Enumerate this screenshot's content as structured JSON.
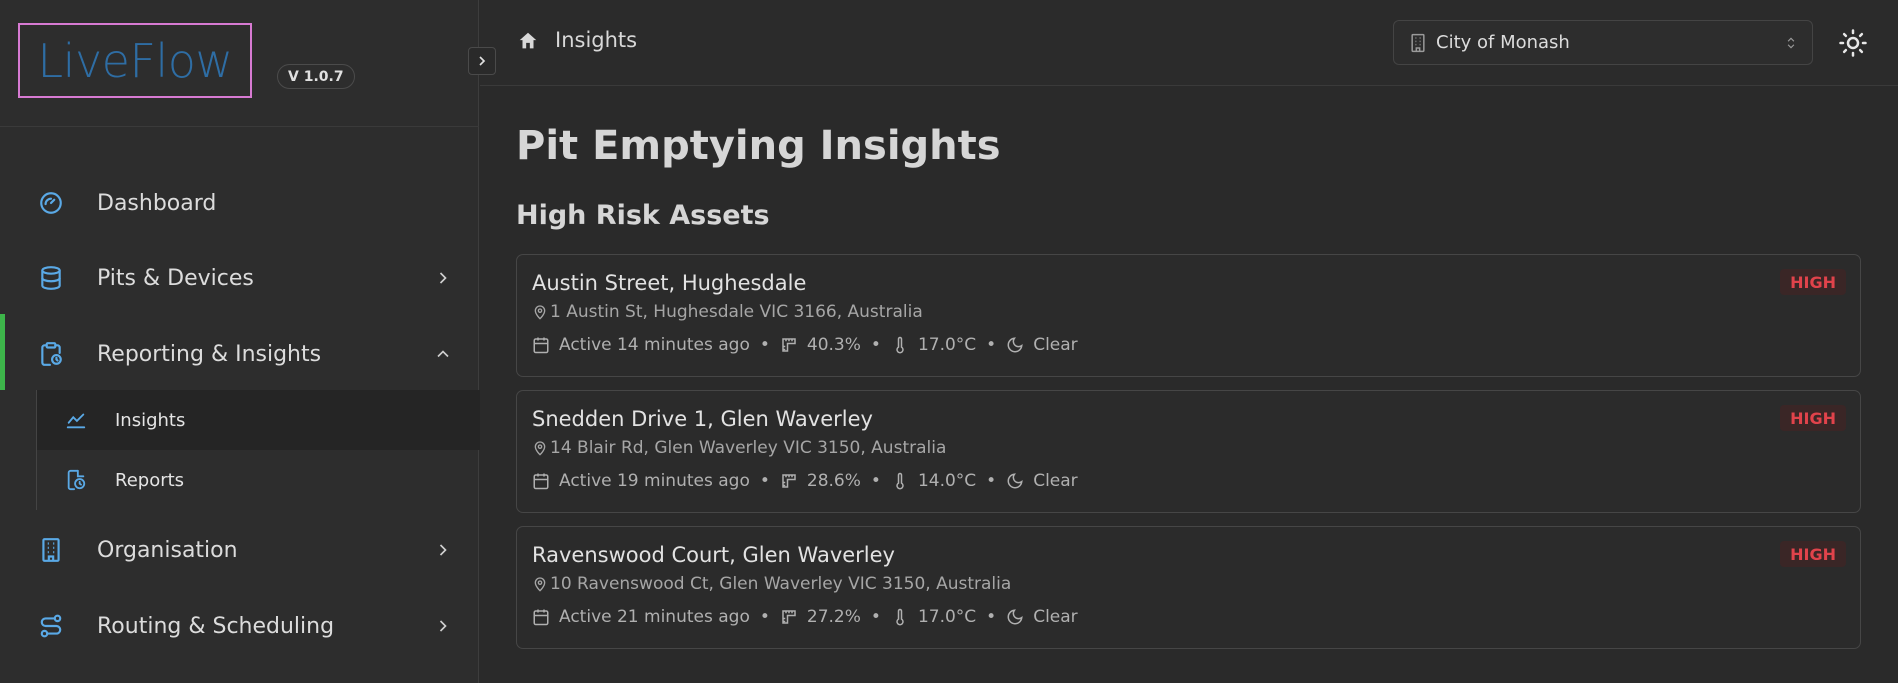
{
  "app": {
    "logo": "LiveFlow",
    "version": "V 1.0.7"
  },
  "sidebar": {
    "items": [
      {
        "label": "Dashboard",
        "icon": "gauge-icon"
      },
      {
        "label": "Pits & Devices",
        "icon": "database-icon",
        "has_children": true
      },
      {
        "label": "Reporting & Insights",
        "icon": "clipboard-clock-icon",
        "expanded": true,
        "active": true
      },
      {
        "label": "Organisation",
        "icon": "building-icon",
        "has_children": true
      },
      {
        "label": "Routing & Scheduling",
        "icon": "route-icon",
        "has_children": true
      }
    ],
    "subitems": [
      {
        "label": "Insights",
        "icon": "line-chart-icon",
        "active": true
      },
      {
        "label": "Reports",
        "icon": "file-clock-icon"
      }
    ]
  },
  "topbar": {
    "breadcrumb": "Insights",
    "organisation": "City of Monash"
  },
  "main": {
    "title": "Pit Emptying Insights",
    "section": "High Risk Assets",
    "assets": [
      {
        "name": "Austin Street, Hughesdale",
        "address": "1 Austin St, Hughesdale VIC 3166, Australia",
        "active": "Active 14 minutes ago",
        "level": "40.3%",
        "temp": "17.0°C",
        "weather": "Clear",
        "risk": "HIGH"
      },
      {
        "name": "Snedden Drive 1, Glen Waverley",
        "address": "14 Blair Rd, Glen Waverley VIC 3150, Australia",
        "active": "Active 19 minutes ago",
        "level": "28.6%",
        "temp": "14.0°C",
        "weather": "Clear",
        "risk": "HIGH"
      },
      {
        "name": "Ravenswood Court, Glen Waverley",
        "address": "10 Ravenswood Ct, Glen Waverley VIC 3150, Australia",
        "active": "Active 21 minutes ago",
        "level": "27.2%",
        "temp": "17.0°C",
        "weather": "Clear",
        "risk": "HIGH"
      }
    ],
    "separator": "•"
  },
  "colors": {
    "accent_active": "#3db54a",
    "icon_blue": "#5aa9e6",
    "logo_text": "#2e6da4",
    "logo_border": "#d77ad2",
    "risk_high": "#e0434b"
  }
}
